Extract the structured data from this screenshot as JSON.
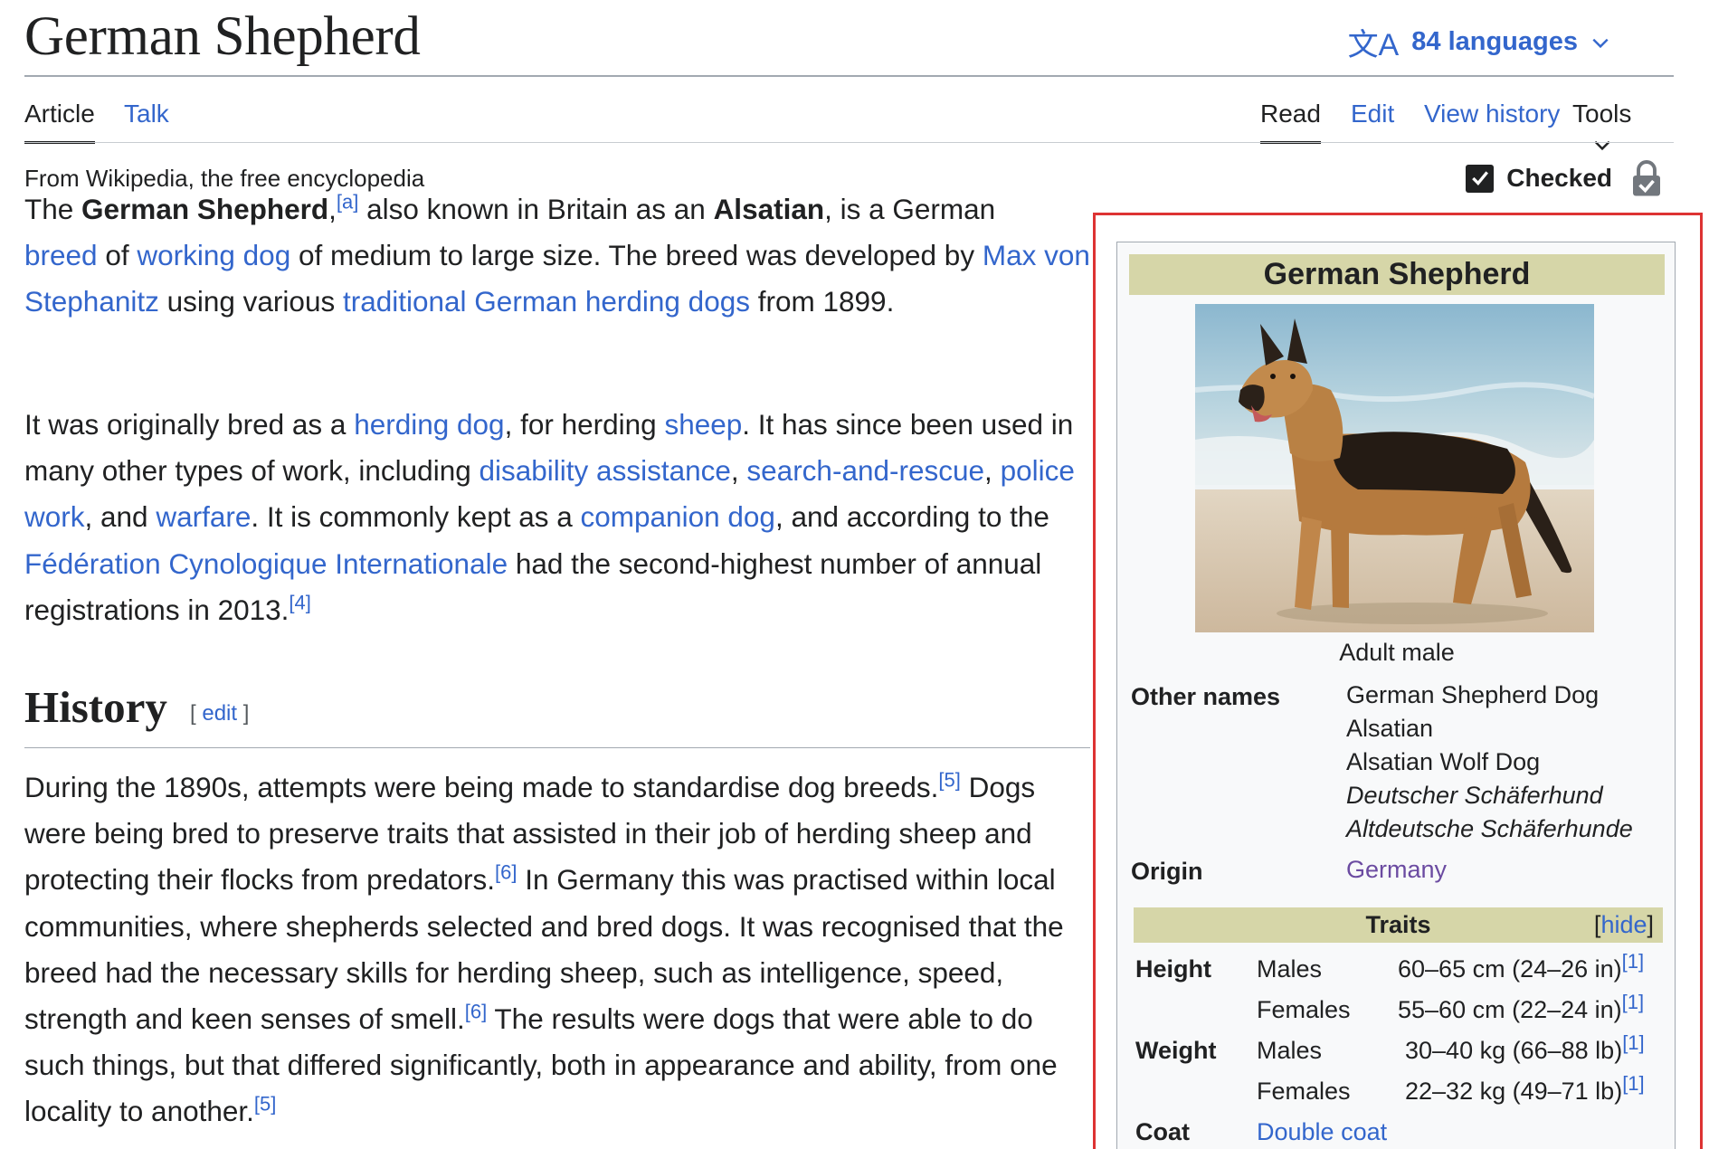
{
  "header": {
    "title": "German Shepherd",
    "languages_label": "84 languages",
    "lang_icon": "文A"
  },
  "tabs": {
    "left": [
      {
        "label": "Article",
        "active": true
      },
      {
        "label": "Talk",
        "active": false
      }
    ],
    "right": [
      {
        "label": "Read",
        "active": true
      },
      {
        "label": "Edit"
      },
      {
        "label": "View history"
      },
      {
        "label": "Tools"
      }
    ]
  },
  "tagline": "From Wikipedia, the free encyclopedia",
  "checked_label": "Checked",
  "article": {
    "p1": {
      "t0": "The ",
      "b0": "German Shepherd",
      "t1": ",",
      "ref_a": "[a]",
      "t2": " also known in Britain as an ",
      "b1": "Alsatian",
      "t3": ", is a German ",
      "l_breed": "breed",
      "t4": " of ",
      "l_working": "working dog",
      "t5": " of medium to large size. The breed was developed by ",
      "l_max": "Max von Stephanitz",
      "t6": " using various ",
      "l_herding": "traditional German herding dogs",
      "t7": " from 1899."
    },
    "p2": {
      "t0": "It was originally bred as a ",
      "l_herding_dog": "herding dog",
      "t1": ", for herding ",
      "l_sheep": "sheep",
      "t2": ". It has since been used in many other types of work, including ",
      "l_disability": "disability assistance",
      "t3": ", ",
      "l_search": "search-and-rescue",
      "t4": ", ",
      "l_police": "police work",
      "t5": ", and ",
      "l_warfare": "warfare",
      "t6": ". It is commonly kept as a ",
      "l_companion": "companion dog",
      "t7": ", and according to the ",
      "l_fci": "Fédération Cynologique Internationale",
      "t8": " had the second-highest number of annual registrations in 2013.",
      "ref4": "[4]"
    },
    "history_heading": "History",
    "history_edit": "edit",
    "p3": {
      "t0": "During the 1890s, attempts were being made to standardise dog breeds.",
      "ref5a": "[5]",
      "t1": " Dogs were being bred to preserve traits that assisted in their job of herding sheep and protecting their flocks from predators.",
      "ref6a": "[6]",
      "t2": " In Germany this was practised within local communities, where shepherds selected and bred dogs. It was recognised that the breed had the necessary skills for herding sheep, such as intelligence, speed, strength and keen senses of smell.",
      "ref6b": "[6]",
      "t3": " The results were dogs that were able to do such things, but that differed significantly, both in appearance and ability, from one locality to another.",
      "ref5b": "[5]"
    }
  },
  "infobox": {
    "title": "German Shepherd",
    "image_caption": "Adult male",
    "other_names_label": "Other names",
    "other_names": [
      "German Shepherd Dog",
      "Alsatian",
      "Alsatian Wolf Dog",
      "Deutscher Schäferhund",
      "Altdeutsche Schäferhunde"
    ],
    "origin_label": "Origin",
    "origin_value": "Germany",
    "traits_label": "Traits",
    "traits_hide": "hide",
    "traits": [
      {
        "label": "Height",
        "sex": "Males",
        "value": "60–65 cm (24–26 in)",
        "ref": "[1]"
      },
      {
        "label": "",
        "sex": "Females",
        "value": "55–60 cm (22–24 in)",
        "ref": "[1]"
      },
      {
        "label": "Weight",
        "sex": "Males",
        "value": "30–40 kg (66–88 lb)",
        "ref": "[1]"
      },
      {
        "label": "",
        "sex": "Females",
        "value": "22–32 kg (49–71 lb)",
        "ref": "[1]"
      }
    ],
    "coat_label": "Coat",
    "coat_value": "Double coat"
  },
  "colors": {
    "link": "#3366cc",
    "visited_link": "#6b4ba1",
    "infobox_header": "#d6d6a8",
    "highlight_border": "#dd3333"
  }
}
